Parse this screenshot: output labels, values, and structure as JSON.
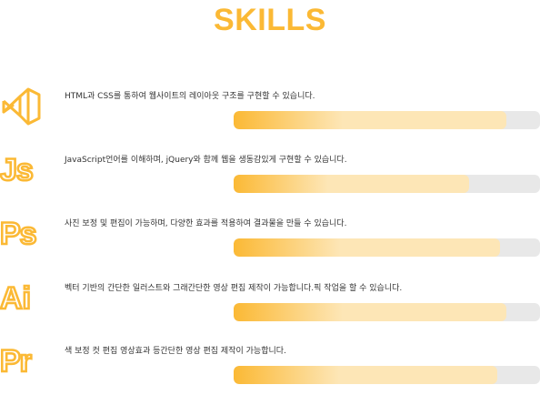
{
  "section": {
    "title": "SKILLS"
  },
  "colors": {
    "accent": "#fbb935",
    "accent_light": "#fde6b6",
    "track": "#e8e8e8"
  },
  "skills": [
    {
      "icon": "vscode-icon",
      "description": "HTML과 CSS를 통하여 웹사이트의 레이아웃 구조를 구현할 수 있습니다.",
      "level": 0.89
    },
    {
      "icon": "javascript-icon",
      "icon_text": "Js",
      "description": "JavaScript언어를 이해하며, jQuery와 함께 웹을 생동감있게 구현할 수 있습니다.",
      "level": 0.77
    },
    {
      "icon": "photoshop-icon",
      "icon_text": "Ps",
      "description": "사진 보정 및 편집이 가능하며, 다양한 효과를 적용하여 결과물을 만들 수 있습니다.",
      "level": 0.87
    },
    {
      "icon": "illustrator-icon",
      "icon_text": "Ai",
      "description": "벡터 기반의 간단한 일러스트와 그래간단한 영상 편집 제작이 가능합니다.픽 작업을 할 수 있습니다.",
      "level": 0.89
    },
    {
      "icon": "premiere-icon",
      "icon_text": "Pr",
      "description": "색 보정 컷 편집 영상효과 등간단한 영상 편집 제작이 가능합니다.",
      "level": 0.86
    }
  ]
}
